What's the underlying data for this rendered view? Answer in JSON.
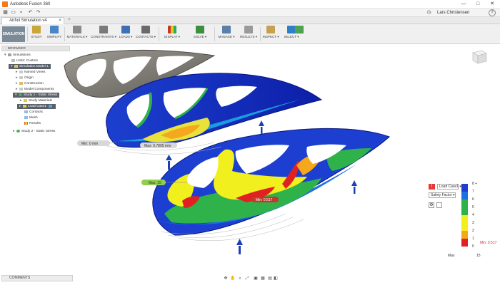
{
  "window": {
    "title": "Autodesk Fusion 360",
    "minimize": "—",
    "maximize": "□",
    "close": "✕"
  },
  "quick_access": {
    "user": "Lars Christensen",
    "help": "?"
  },
  "document": {
    "tab_label": "Airfoil Simulation v4",
    "close": "×",
    "new_tab": "+"
  },
  "ribbon": {
    "workspace": "SIMULATION ▾",
    "tools": [
      {
        "label": "STUDY",
        "icon": "study-icon",
        "color": "#c9a73a"
      },
      {
        "label": "SIMPLIFY",
        "icon": "simplify-icon",
        "color": "#4a86c5"
      },
      {
        "label": "MATERIALS ▾",
        "icon": "materials-icon",
        "color": "#8a8a8a"
      },
      {
        "label": "CONSTRAINTS ▾",
        "icon": "constraints-icon",
        "color": "#7a7a7a"
      },
      {
        "label": "LOADS ▾",
        "icon": "loads-icon",
        "color": "#3f6fb5"
      },
      {
        "label": "CONTACTS ▾",
        "icon": "contacts-icon",
        "color": "#6a6a6a"
      },
      {
        "label": "DISPLAY ▾",
        "icon": "display-icon",
        "color": "#c0392b"
      },
      {
        "label": "SOLVE ▾",
        "icon": "solve-icon",
        "color": "#3c8f3c"
      },
      {
        "label": "MANAGE ▾",
        "icon": "manage-icon",
        "color": "#5a7fa8"
      },
      {
        "label": "RESULTS ▾",
        "icon": "results-icon",
        "color": "#9a9a9a"
      },
      {
        "label": "INSPECT ▾",
        "icon": "inspect-icon",
        "color": "#c9a050"
      },
      {
        "label": "SELECT ▾",
        "icon": "select-icon",
        "color": "#2f7fc6"
      }
    ]
  },
  "browser": {
    "title": "BROWSER",
    "nodes": [
      {
        "label": "Simulations",
        "indent": 0
      },
      {
        "label": "Units: Custom",
        "indent": 1
      },
      {
        "label": "Simulation Model 1",
        "indent": 1,
        "dark": true
      },
      {
        "label": "Named Views",
        "indent": 2
      },
      {
        "label": "Origin",
        "indent": 2
      },
      {
        "label": "Construction",
        "indent": 2
      },
      {
        "label": "Model Components",
        "indent": 2
      },
      {
        "label": "Study 1 - Static Stress",
        "indent": 2,
        "dark": true
      },
      {
        "label": "Study Materials",
        "indent": 3
      },
      {
        "label": "Load Case1",
        "indent": 3,
        "dark": true
      },
      {
        "label": "Contacts",
        "indent": 3
      },
      {
        "label": "Mesh",
        "indent": 3
      },
      {
        "label": "Results",
        "indent": 3
      },
      {
        "label": "Study 2 - Static Stress",
        "indent": 2
      }
    ]
  },
  "viewport": {
    "probe_min_disp": "Min: 0 mm",
    "probe_max_disp": "Max: 0.7805 mm",
    "probe_max_sf": "Max: 15",
    "probe_min_sf": "Min: 0.517"
  },
  "legend": {
    "load_case": "Load Case1 ▾",
    "result_type": "Safety Factor ▾",
    "gear": "⚙",
    "ticks": [
      "8 +",
      "7",
      "6",
      "5",
      "4",
      "3",
      "2",
      "1",
      "0"
    ],
    "colors": [
      "#1c3fd1",
      "#1f6fe0",
      "#2fb24a",
      "#2fb24a",
      "#f2ef1e",
      "#f2ef1e",
      "#f6a81c",
      "#e12121"
    ],
    "min_label": "Min: 0.517",
    "max_label": "Max",
    "max_value": "15"
  },
  "bottom": {
    "comments": "COMMENTS",
    "nav_icons": [
      "✥",
      "✋",
      "⌕",
      "⤢",
      "▣",
      "▦",
      "▤",
      "◧"
    ]
  }
}
